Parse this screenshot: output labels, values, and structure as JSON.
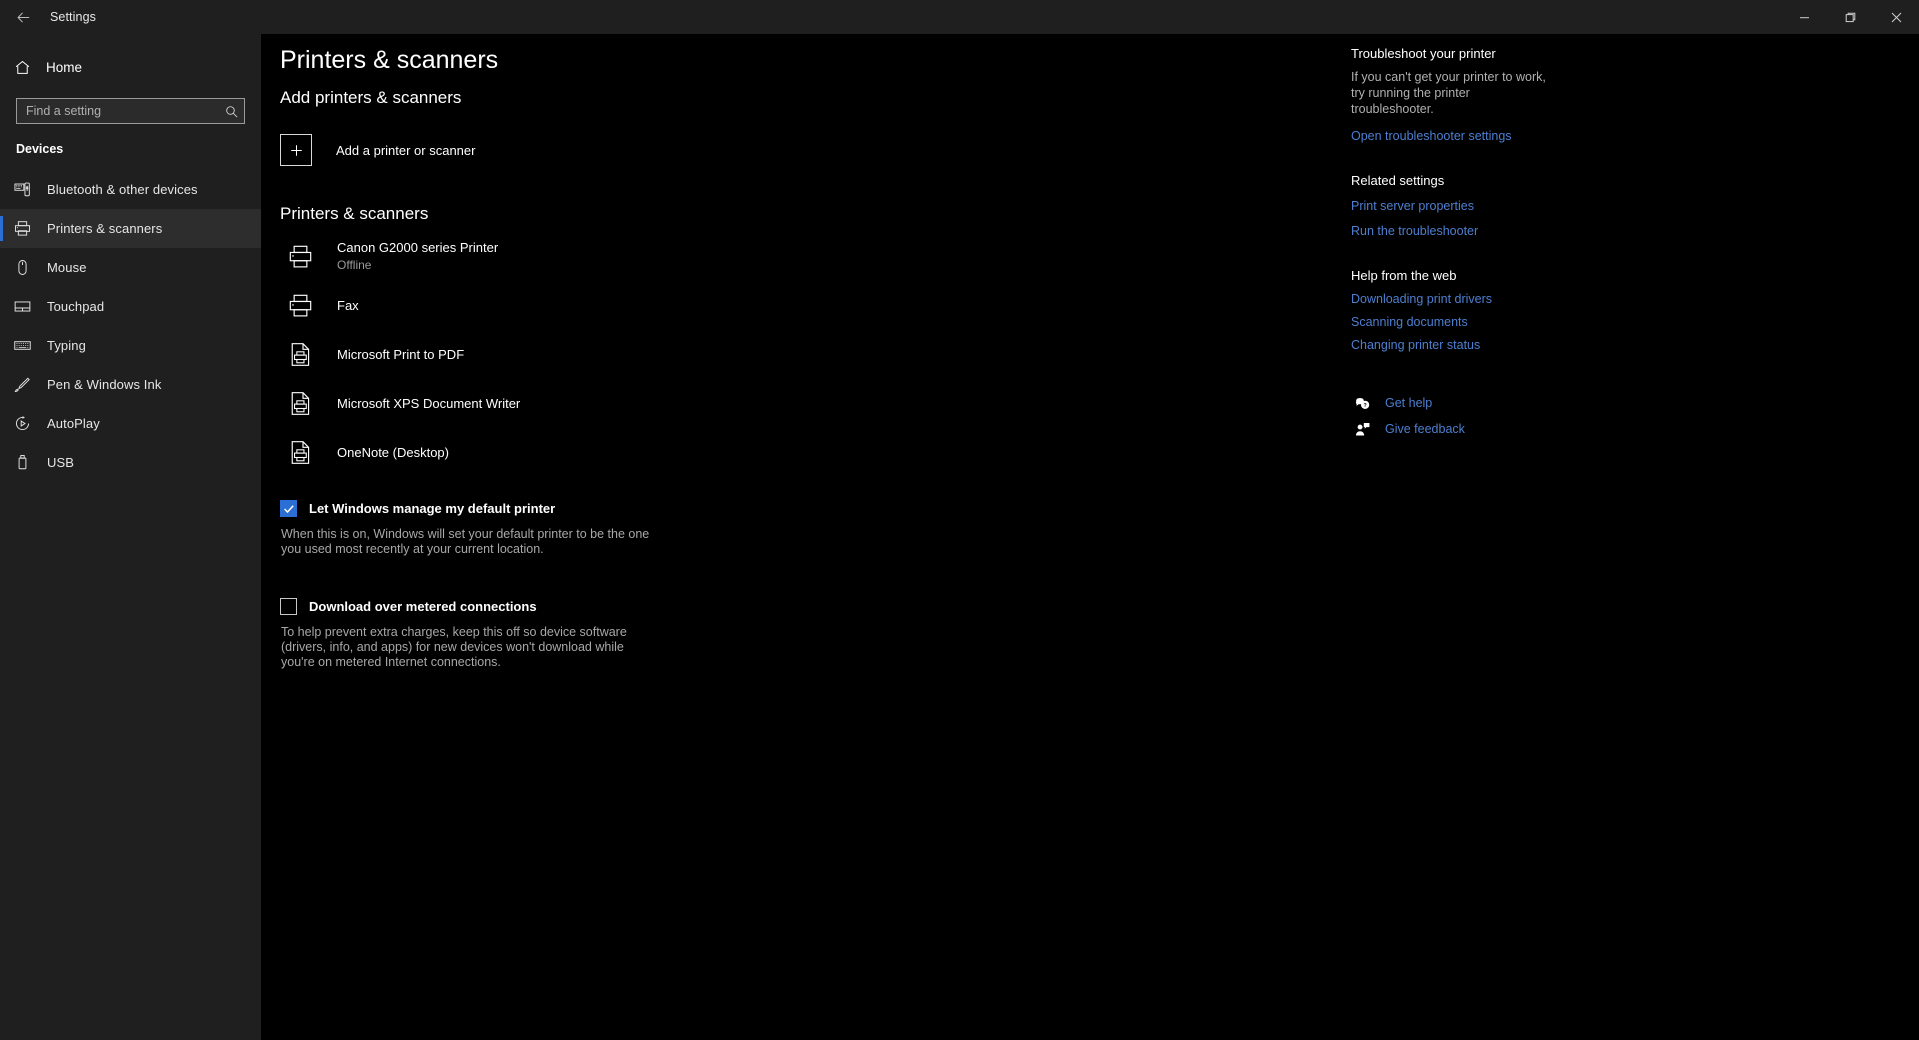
{
  "titlebar": {
    "back_label": "back-arrow",
    "title": "Settings",
    "minimize": "minimize",
    "maximize": "maximize",
    "close": "close"
  },
  "sidebar": {
    "home_label": "Home",
    "search": {
      "placeholder": "Find a setting",
      "value": ""
    },
    "group_header": "Devices",
    "items": [
      {
        "label": "Bluetooth & other devices",
        "icon": "bluetooth-devices-icon",
        "selected": false
      },
      {
        "label": "Printers & scanners",
        "icon": "printer-icon",
        "selected": true
      },
      {
        "label": "Mouse",
        "icon": "mouse-icon",
        "selected": false
      },
      {
        "label": "Touchpad",
        "icon": "touchpad-icon",
        "selected": false
      },
      {
        "label": "Typing",
        "icon": "keyboard-icon",
        "selected": false
      },
      {
        "label": "Pen & Windows Ink",
        "icon": "pen-icon",
        "selected": false
      },
      {
        "label": "AutoPlay",
        "icon": "autoplay-icon",
        "selected": false
      },
      {
        "label": "USB",
        "icon": "usb-icon",
        "selected": false
      }
    ]
  },
  "main": {
    "page_title": "Printers & scanners",
    "add_section": {
      "title": "Add printers & scanners",
      "add_label": "Add a printer or scanner",
      "plus_icon": "plus-icon"
    },
    "printers_section": {
      "title": "Printers & scanners",
      "items": [
        {
          "name": "Canon G2000 series Printer",
          "status": "Offline",
          "icon": "printer-icon"
        },
        {
          "name": "Fax",
          "status": "",
          "icon": "printer-icon"
        },
        {
          "name": "Microsoft Print to PDF",
          "status": "",
          "icon": "print-to-file-icon"
        },
        {
          "name": "Microsoft XPS Document Writer",
          "status": "",
          "icon": "print-to-file-icon"
        },
        {
          "name": "OneNote (Desktop)",
          "status": "",
          "icon": "print-to-file-icon"
        }
      ]
    },
    "default_printer": {
      "label": "Let Windows manage my default printer",
      "checked": true,
      "description": "When this is on, Windows will set your default printer to be the one you used most recently at your current location."
    },
    "metered": {
      "label": "Download over metered connections",
      "checked": false,
      "description": "To help prevent extra charges, keep this off so device software (drivers, info, and apps) for new devices won't download while you're on metered Internet connections."
    }
  },
  "right_panel": {
    "troubleshoot": {
      "header": "Troubleshoot your printer",
      "body": "If you can't get your printer to work, try running the printer troubleshooter.",
      "link": "Open troubleshooter settings"
    },
    "related": {
      "header": "Related settings",
      "links": [
        "Print server properties",
        "Run the troubleshooter"
      ]
    },
    "help_web": {
      "header": "Help from the web",
      "links": [
        "Downloading print drivers",
        "Scanning documents",
        "Changing printer status"
      ]
    },
    "footer": [
      {
        "label": "Get help",
        "icon": "help-bubble-icon"
      },
      {
        "label": "Give feedback",
        "icon": "feedback-person-icon"
      }
    ]
  },
  "colors": {
    "accent": "#2b6fd4",
    "link": "#4d7fd0",
    "sidebar_bg": "#1f1f1f",
    "main_bg": "#000000",
    "secondary_text": "#9a9a9a"
  }
}
